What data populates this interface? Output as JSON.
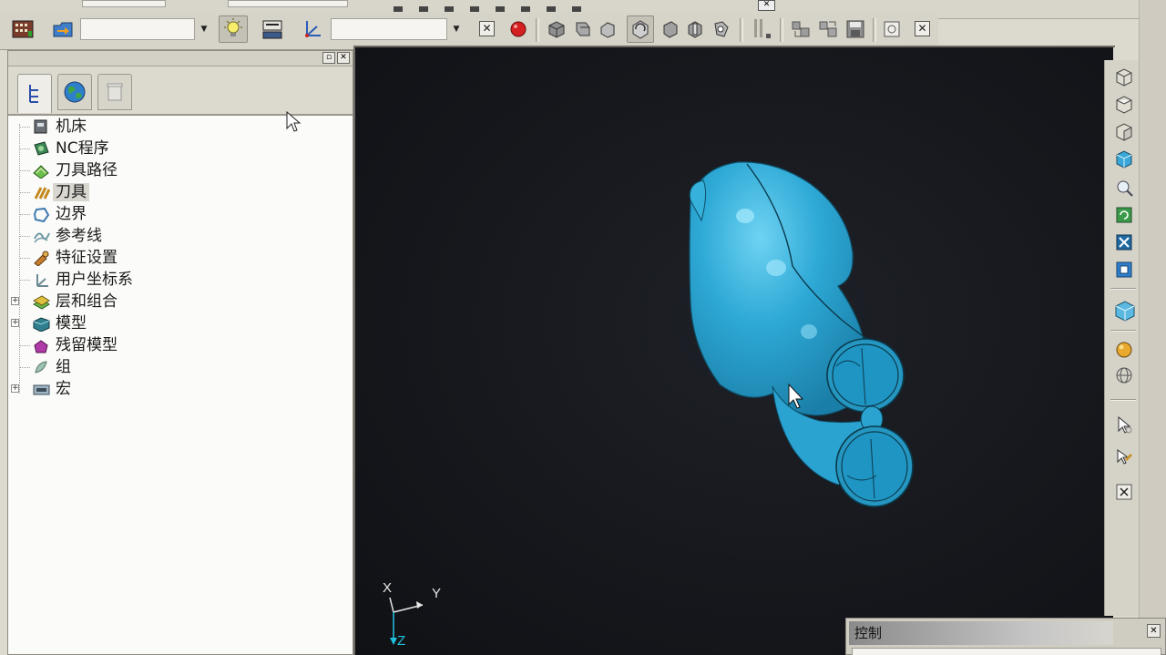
{
  "toolbar": {
    "combo1_value": "",
    "combo2_value": "",
    "buttons": [
      "machine-view-icon",
      "open-folder-icon",
      "light-bulb-icon",
      "nc-output-icon",
      "workplane-icon",
      "stop-record-icon",
      "iso-view-icon",
      "front-view-icon",
      "side-view-icon",
      "rotate-view-icon",
      "back-view-icon",
      "bottom-view-icon",
      "spin-view-icon",
      "simulate-icon",
      "simulate-step-icon",
      "save-icon",
      "info-icon"
    ]
  },
  "explorer": {
    "tabs": [
      "tree-tab",
      "globe-tab",
      "trash-tab"
    ],
    "items": [
      {
        "label": "机床",
        "icon": "machine-icon",
        "expandable": false
      },
      {
        "label": "NC程序",
        "icon": "nc-program-icon",
        "expandable": false
      },
      {
        "label": "刀具路径",
        "icon": "toolpath-icon",
        "expandable": false
      },
      {
        "label": "刀具",
        "icon": "tool-icon",
        "expandable": false,
        "selected": true
      },
      {
        "label": "边界",
        "icon": "boundary-icon",
        "expandable": false
      },
      {
        "label": "参考线",
        "icon": "pattern-icon",
        "expandable": false
      },
      {
        "label": "特征设置",
        "icon": "feature-icon",
        "expandable": false
      },
      {
        "label": "用户坐标系",
        "icon": "ucs-icon",
        "expandable": false
      },
      {
        "label": "层和组合",
        "icon": "layers-icon",
        "expandable": true
      },
      {
        "label": "模型",
        "icon": "model-icon",
        "expandable": true
      },
      {
        "label": "残留模型",
        "icon": "stock-model-icon",
        "expandable": false
      },
      {
        "label": "组",
        "icon": "group-icon",
        "expandable": false
      },
      {
        "label": "宏",
        "icon": "macro-icon",
        "expandable": true
      }
    ]
  },
  "viewport": {
    "model_color": "#2ea9d6",
    "background": "#16181d",
    "axis": {
      "x": "X",
      "y": "Y",
      "z": "Z"
    }
  },
  "side_toolbar": {
    "buttons": [
      "view-front-cube-icon",
      "view-top-cube-icon",
      "view-right-cube-icon",
      "view-iso-cube-icon",
      "zoom-icon",
      "refresh-icon",
      "fit-icon",
      "box-zoom-icon",
      "shaded-cube-icon",
      "shade-sphere-icon",
      "wireframe-sphere-icon",
      "select-icon",
      "drag-icon",
      "close-icon"
    ]
  },
  "control": {
    "title": "控制"
  }
}
